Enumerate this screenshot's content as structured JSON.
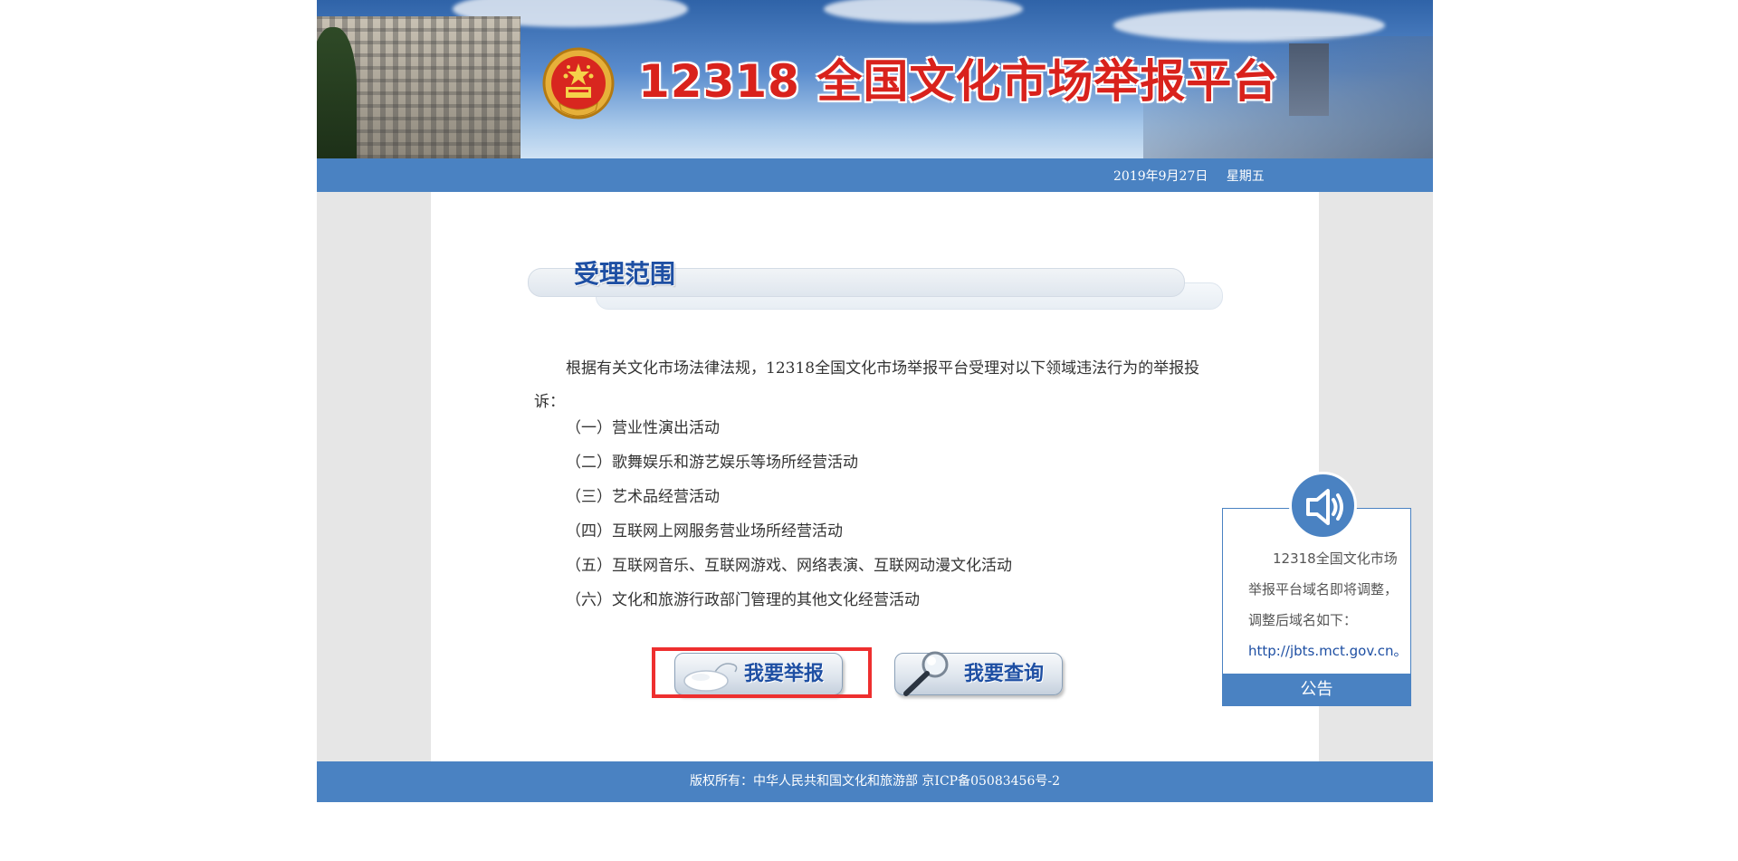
{
  "header": {
    "site_title": "12318 全国文化市场举报平台"
  },
  "date_bar": {
    "date": "2019年9月27日",
    "weekday": "星期五"
  },
  "scope": {
    "title": "受理范围",
    "intro": "根据有关文化市场法律法规，12318全国文化市场举报平台受理对以下领域违法行为的举报投诉：",
    "items": [
      "（一）营业性演出活动",
      "（二）歌舞娱乐和游艺娱乐等场所经营活动",
      "（三）艺术品经营活动",
      "（四）互联网上网服务营业场所经营活动",
      "（五）互联网音乐、互联网游戏、网络表演、互联网动漫文化活动",
      "（六）文化和旅游行政部门管理的其他文化经营活动"
    ]
  },
  "actions": {
    "report_label": "我要举报",
    "query_label": "我要查询"
  },
  "notice": {
    "lines": [
      "12318全国文化市场",
      "举报平台域名即将调整，",
      "调整后域名如下：",
      "http://jbts.mct.gov.cn。"
    ],
    "label": "公告"
  },
  "footer": {
    "copyright": "版权所有：中华人民共和国文化和旅游部 京ICP备05083456号-2"
  },
  "colors": {
    "primary_blue": "#4a82c2",
    "title_red": "#d9221c",
    "heading_blue": "#1e4fa3",
    "highlight_red": "#ee2f2f",
    "page_gray": "#e6e6e6"
  },
  "icons": {
    "emblem": "national-emblem-icon",
    "report": "mouse-icon",
    "query": "magnifier-icon",
    "notice": "speaker-icon"
  }
}
